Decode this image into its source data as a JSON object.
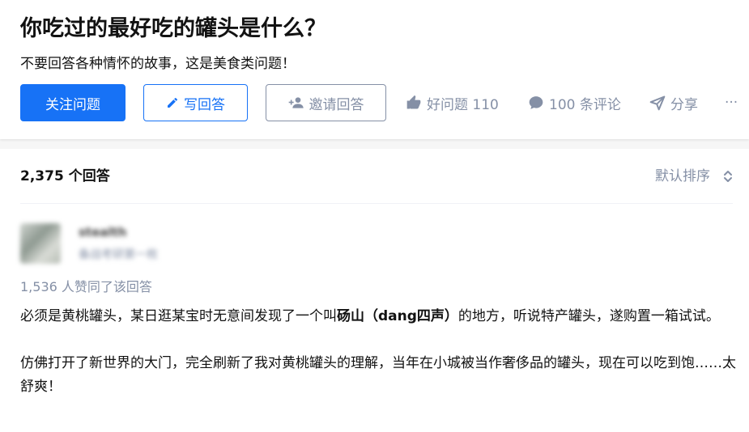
{
  "question": {
    "title": "你吃过的最好吃的罐头是什么？",
    "description": "不要回答各种情怀的故事，这是美食类问题！"
  },
  "actions": {
    "follow_label": "关注问题",
    "write_label": "写回答",
    "invite_label": "邀请回答",
    "good_question_label": "好问题 110",
    "comments_label": "100 条评论",
    "share_label": "分享",
    "more_label": "···"
  },
  "answers": {
    "count_label": "2,375 个回答",
    "sort_label": "默认排序"
  },
  "answer": {
    "author_name": "stealth",
    "author_bio": "备战考研第一枚",
    "likes_text": "1,536 人赞同了该回答",
    "p1_before": "必须是黄桃罐头，某日逛某宝时无意间发现了一个叫",
    "p1_bold": "砀山（dang四声）",
    "p1_after": "的地方，听说特产罐头，遂购置一箱试试。",
    "p2": "仿佛打开了新世界的大门，完全刷新了我对黄桃罐头的理解，当年在小城被当作奢侈品的罐头，现在可以吃到饱……太舒爽！"
  },
  "colors": {
    "primary": "#1772f6",
    "muted": "#8590a6",
    "text": "#121212"
  },
  "icons": [
    "pencil-icon",
    "add-user-icon",
    "thumb-up-icon",
    "comment-icon",
    "share-icon",
    "more-icon",
    "sort-icon"
  ]
}
